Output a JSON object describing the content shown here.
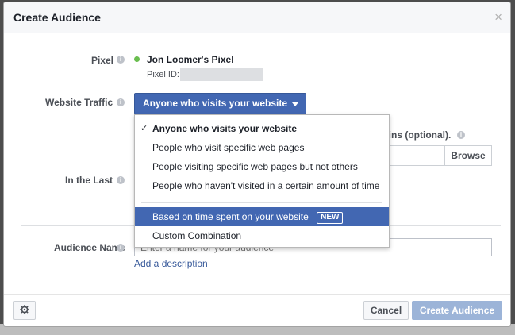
{
  "dialog": {
    "title": "Create Audience",
    "close_icon": "×"
  },
  "pixel": {
    "label": "Pixel",
    "name": "Jon Loomer's Pixel",
    "id_label": "Pixel ID:",
    "status_color": "#6abe4f"
  },
  "website_traffic": {
    "label": "Website Traffic",
    "selected": "Anyone who visits your website"
  },
  "domains": {
    "label_fragment": "ains (optional).",
    "browse_label": "Browse"
  },
  "in_the_last": {
    "label": "In the Last"
  },
  "dropdown": {
    "items": [
      {
        "label": "Anyone who visits your website",
        "checked": true
      },
      {
        "label": "People who visit specific web pages"
      },
      {
        "label": "People visiting specific web pages but not others"
      },
      {
        "label": "People who haven't visited in a certain amount of time"
      },
      {
        "label": "Based on time spent on your website",
        "badge": "NEW",
        "highlighted": true
      },
      {
        "label": "Custom Combination"
      }
    ]
  },
  "audience_name": {
    "label": "Audience Name",
    "placeholder": "Enter a name for your audience",
    "add_description": "Add a description"
  },
  "footer": {
    "settings_icon": "gear-icon",
    "cancel_label": "Cancel",
    "create_label": "Create Audience"
  },
  "colors": {
    "primary": "#4267b2",
    "link": "#365899",
    "disabled_primary": "#9cb4d8"
  }
}
